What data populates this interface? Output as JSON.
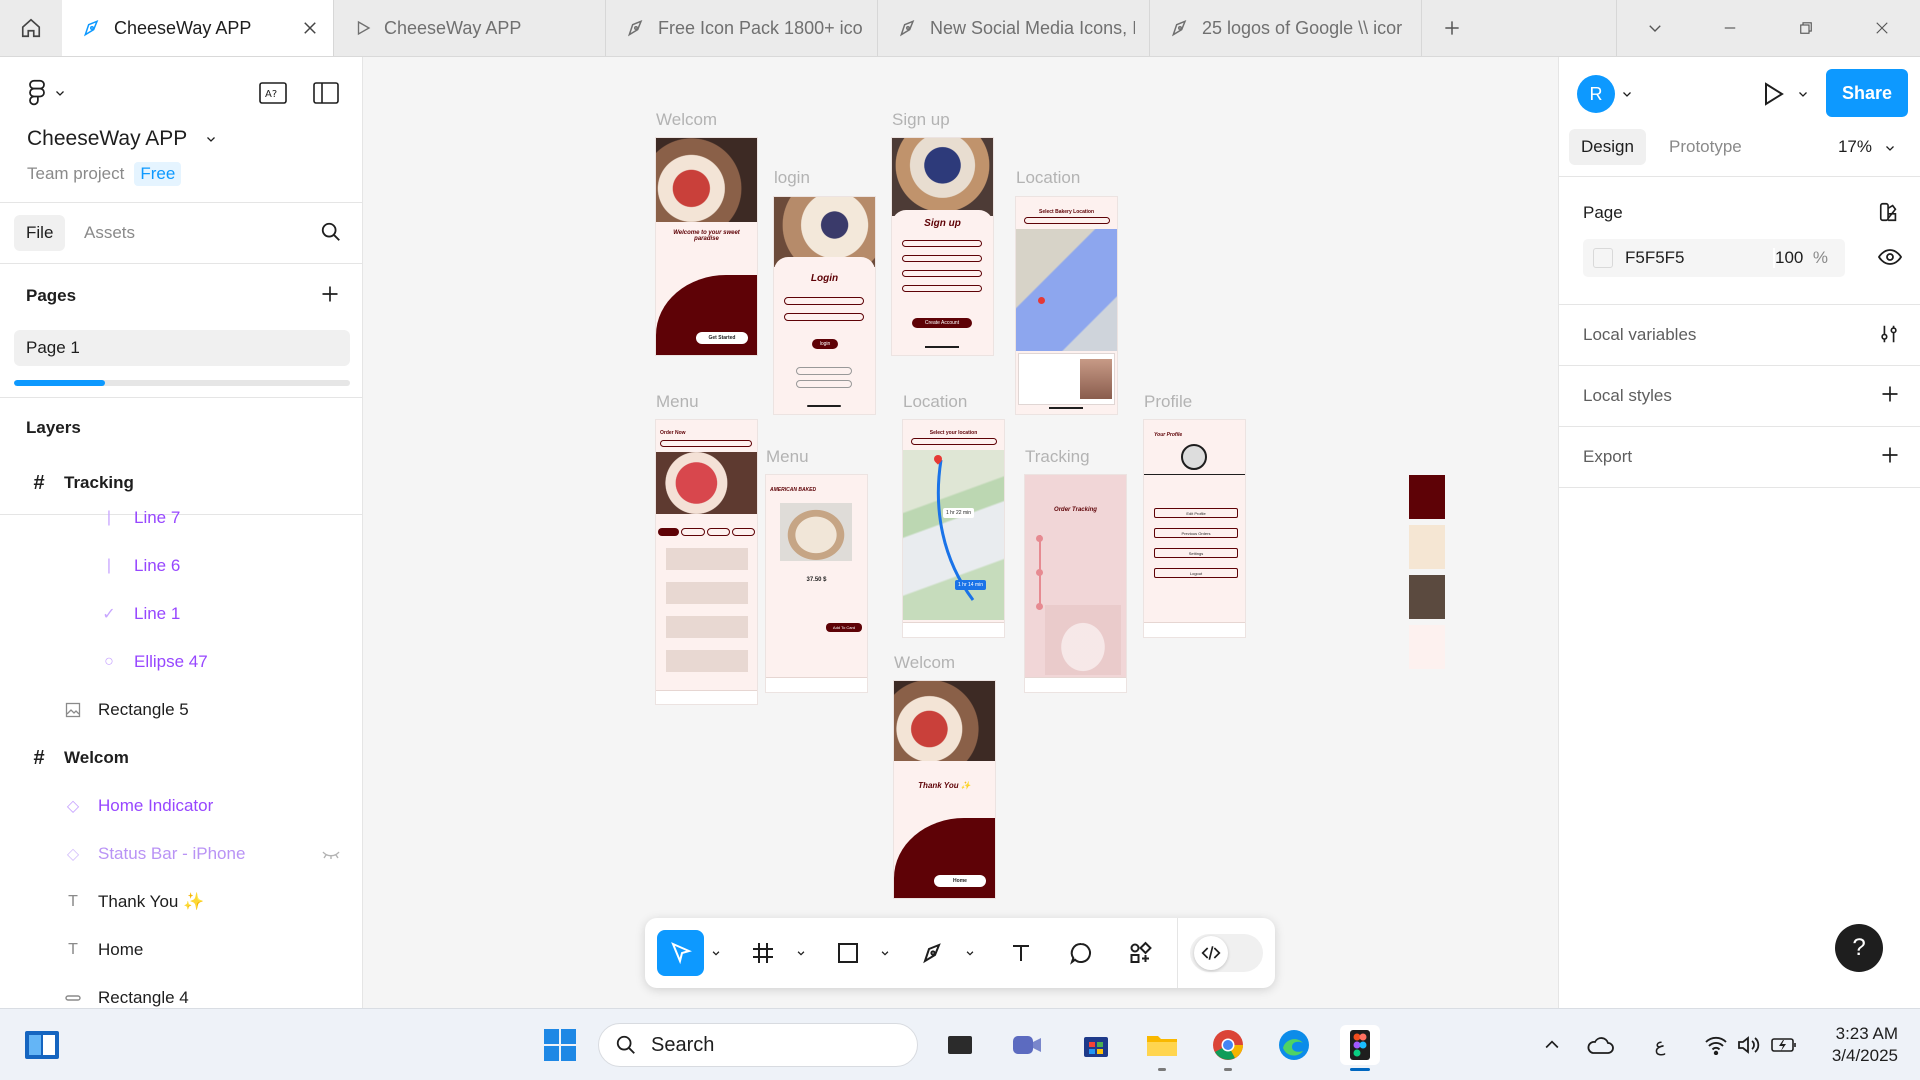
{
  "browser": {
    "tabs": [
      {
        "label": "CheeseWay APP",
        "active": true
      },
      {
        "label": "CheeseWay APP",
        "active": false
      },
      {
        "label": "Free Icon Pack 1800+ ico",
        "active": false
      },
      {
        "label": "New Social Media Icons, I",
        "active": false
      },
      {
        "label": "25 logos of Google \\\\ icor",
        "active": false
      }
    ]
  },
  "left_panel": {
    "project_name": "CheeseWay APP",
    "team_text": "Team project",
    "plan_badge": "Free",
    "file_tab": "File",
    "assets_tab": "Assets",
    "pages_title": "Pages",
    "current_page": "Page 1",
    "pages_scroll_fraction": 0.27,
    "layers_title": "Layers",
    "layers": [
      {
        "name": "Tracking",
        "kind": "frame"
      },
      {
        "name": "Line 7",
        "kind": "line"
      },
      {
        "name": "Line 6",
        "kind": "line"
      },
      {
        "name": "Line 1",
        "kind": "check"
      },
      {
        "name": "Ellipse 47",
        "kind": "ellipse"
      },
      {
        "name": "Rectangle 5",
        "kind": "image"
      },
      {
        "name": "Welcom",
        "kind": "frame"
      },
      {
        "name": "Home Indicator",
        "kind": "component"
      },
      {
        "name": "Status Bar - iPhone",
        "kind": "component"
      },
      {
        "name": "Thank You ✨",
        "kind": "text"
      },
      {
        "name": "Home",
        "kind": "text"
      },
      {
        "name": "Rectangle 4",
        "kind": "rect"
      }
    ]
  },
  "right_panel": {
    "avatar_initial": "R",
    "share_label": "Share",
    "design_tab": "Design",
    "prototype_tab": "Prototype",
    "zoom": "17%",
    "page_title": "Page",
    "page_fill_hex": "F5F5F5",
    "page_fill_opacity": "100",
    "percent_sign": "%",
    "local_variables": "Local variables",
    "local_styles": "Local styles",
    "export": "Export"
  },
  "canvas": {
    "frame_labels": {
      "welcom_1": "Welcom",
      "login": "login",
      "signup": "Sign up",
      "location_1": "Location",
      "menu_1": "Menu",
      "menu_2": "Menu",
      "location_2": "Location",
      "tracking": "Tracking",
      "profile": "Profile",
      "welcom_2": "Welcom"
    },
    "mock_text": {
      "welcome_heading": "Welcome to your sweet paradise",
      "get_started": "Get Started",
      "login_heading": "Login",
      "login_btn": "login",
      "signup_heading": "Sign up",
      "create_account": "Create Account",
      "select_bakery": "Select Bakery Location",
      "select_location": "Select your location",
      "order_now": "Order Now",
      "american_baked": "AMERICAN BAKED",
      "price": "37.50 $",
      "add_to_card": "Add To Card",
      "order_tracking": "Order Tracking",
      "your_profile": "Your Profile",
      "edit_profile": "Edit Profile",
      "previous_orders": "Previous Orders",
      "settings": "Settings",
      "logout": "Logout",
      "thank_you": "Thank You ✨",
      "home_btn": "Home",
      "route_1": "1 hr 22 min",
      "route_2": "1 hr 14 min"
    },
    "palette": [
      "#5e0206",
      "#f5e6d3",
      "#5b4a3f",
      "#fdf1ef"
    ]
  },
  "taskbar": {
    "search_placeholder": "Search",
    "time": "3:23 AM",
    "date": "3/4/2025",
    "lang": "ع"
  }
}
